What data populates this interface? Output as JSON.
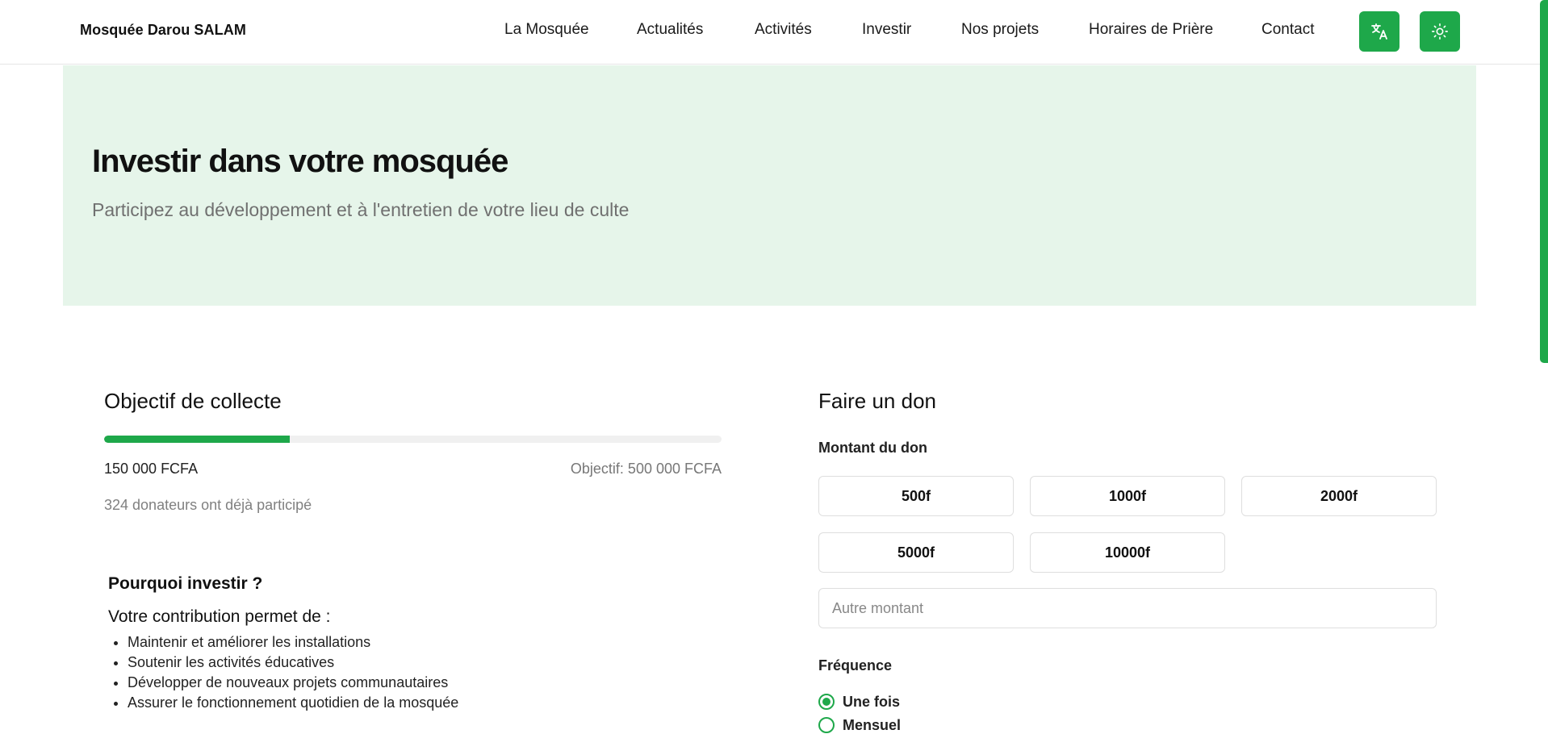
{
  "header": {
    "brand": "Mosquée Darou SALAM",
    "nav": [
      {
        "label": "La Mosquée"
      },
      {
        "label": "Actualités"
      },
      {
        "label": "Activités"
      },
      {
        "label": "Investir"
      },
      {
        "label": "Nos projets"
      },
      {
        "label": "Horaires de Prière"
      },
      {
        "label": "Contact"
      }
    ],
    "icons": {
      "language": "translate-icon",
      "theme": "sun-icon"
    },
    "accent_color": "#1ea84a"
  },
  "hero": {
    "title": "Investir dans votre mosquée",
    "subtitle": "Participez au développement et à l'entretien de votre lieu de culte",
    "background": "#e6f5ea"
  },
  "goal": {
    "title": "Objectif de collecte",
    "progress_fraction": 0.3,
    "raised": "150 000 FCFA",
    "target": "Objectif: 500 000 FCFA",
    "donors": "324 donateurs ont déjà participé"
  },
  "why": {
    "title": "Pourquoi investir ?",
    "subtitle": "Votre contribution permet de :",
    "items": [
      "Maintenir et améliorer les installations",
      "Soutenir les activités éducatives",
      "Développer de nouveaux projets communautaires",
      "Assurer le fonctionnement quotidien de la mosquée"
    ]
  },
  "donation": {
    "title": "Faire un don",
    "amount_label": "Montant du don",
    "amounts": [
      "500f",
      "1000f",
      "2000f",
      "5000f",
      "10000f"
    ],
    "other_placeholder": "Autre montant",
    "other_value": "",
    "frequency_label": "Fréquence",
    "frequencies": [
      {
        "label": "Une fois",
        "checked": true
      },
      {
        "label": "Mensuel",
        "checked": false
      }
    ]
  }
}
